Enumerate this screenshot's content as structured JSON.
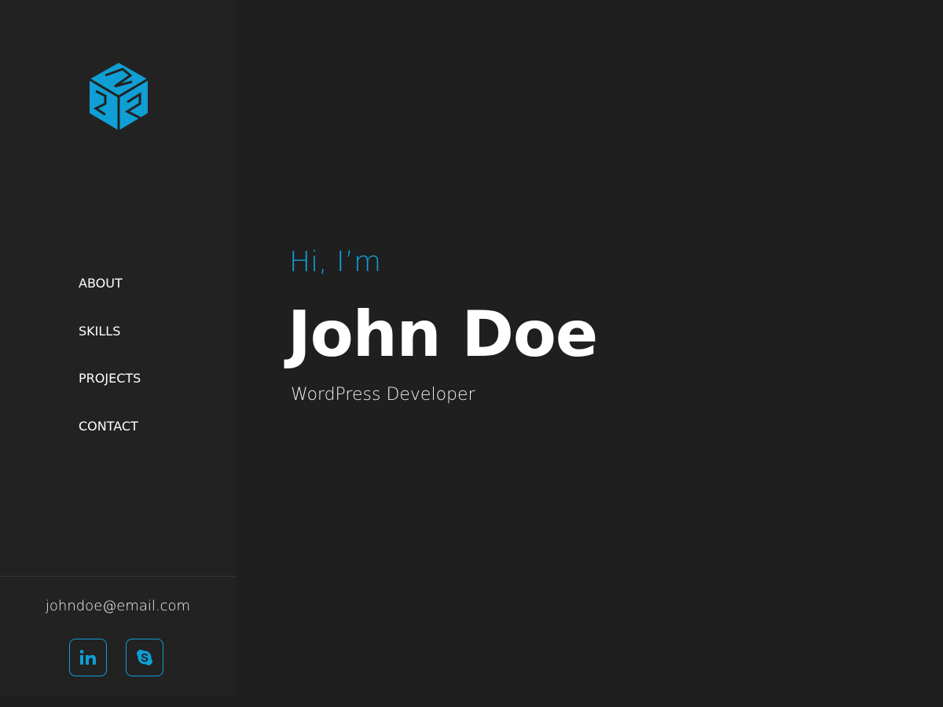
{
  "brand": {
    "logo_icon": "cube-logo-icon",
    "accent_color": "#0f9fd4"
  },
  "nav": {
    "items": [
      {
        "label": "ABOUT"
      },
      {
        "label": "SKILLS"
      },
      {
        "label": "PROJECTS"
      },
      {
        "label": "CONTACT"
      }
    ]
  },
  "contact": {
    "email": "johndoe@email.com"
  },
  "socials": [
    {
      "icon": "linkedin-icon"
    },
    {
      "icon": "skype-icon"
    }
  ],
  "hero": {
    "greeting": "Hi, I’m",
    "name": "John Doe",
    "role": "WordPress Developer"
  }
}
